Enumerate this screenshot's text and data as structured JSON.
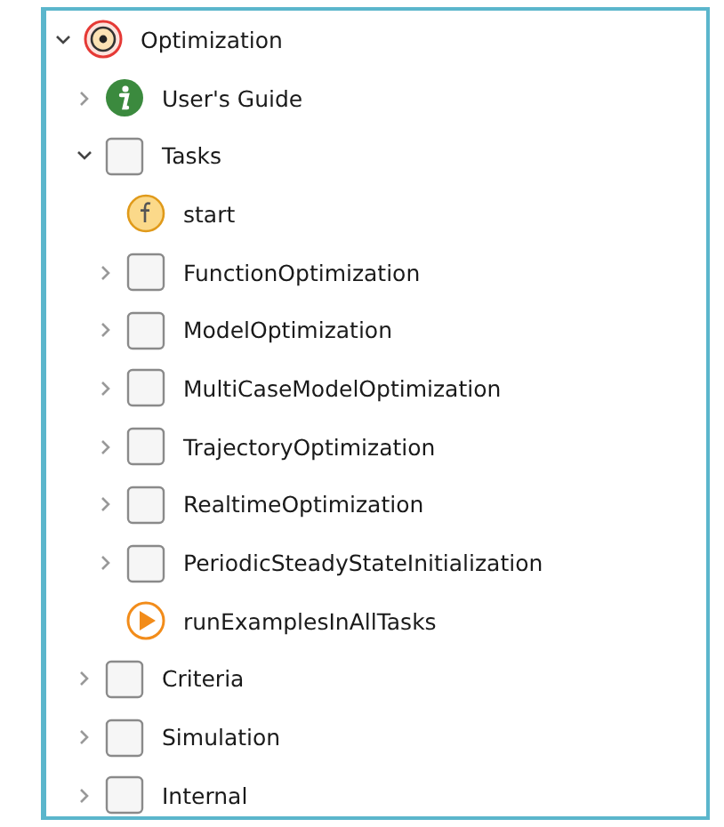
{
  "tree": [
    {
      "label": "Optimization",
      "kind": "package",
      "expanded": true,
      "children": [
        {
          "label": "User's Guide",
          "kind": "info",
          "expanded": false
        },
        {
          "label": "Tasks",
          "kind": "folder",
          "expanded": true,
          "children": [
            {
              "label": "start",
              "kind": "function"
            },
            {
              "label": "FunctionOptimization",
              "kind": "folder",
              "expanded": false
            },
            {
              "label": "ModelOptimization",
              "kind": "folder",
              "expanded": false
            },
            {
              "label": "MultiCaseModelOptimization",
              "kind": "folder",
              "expanded": false
            },
            {
              "label": "TrajectoryOptimization",
              "kind": "folder",
              "expanded": false
            },
            {
              "label": "RealtimeOptimization",
              "kind": "folder",
              "expanded": false
            },
            {
              "label": "PeriodicSteadyStateInitialization",
              "kind": "folder",
              "expanded": false
            },
            {
              "label": "runExamplesInAllTasks",
              "kind": "run"
            }
          ]
        },
        {
          "label": "Criteria",
          "kind": "folder",
          "expanded": false
        },
        {
          "label": "Simulation",
          "kind": "folder",
          "expanded": false
        },
        {
          "label": "Internal",
          "kind": "folder",
          "expanded": false
        }
      ]
    }
  ]
}
